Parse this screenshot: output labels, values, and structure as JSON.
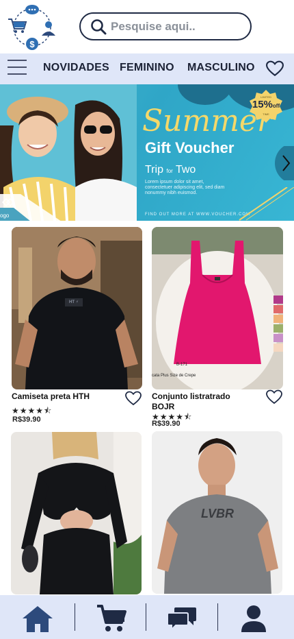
{
  "header": {
    "search_placeholder": "Pesquise aqui.."
  },
  "nav": {
    "items": [
      "NOVIDADES",
      "FEMININO",
      "MASCULINO"
    ]
  },
  "banner": {
    "title": "Summer",
    "subtitle": "Gift Voucher",
    "trip_prefix": "Trip",
    "trip_for": "for",
    "trip_suffix": "Two",
    "body": "Lorem ipsum dolor sit amet, consectetuer adipiscing elit, sed diam nonummy nibh euismod.",
    "find_out": "FIND OUT MORE AT WWW.VOUCHER.COM",
    "badge_percent": "15%",
    "badge_off": "off",
    "badge_top": "LIMITED",
    "badge_bottom": "TIME",
    "logo_text": "ogo"
  },
  "products": [
    {
      "name": "Camiseta preta HTH",
      "rating": 4.5,
      "stars": "★★★★⯪",
      "price": "R$39.90",
      "shirt_print": "HT ⚡"
    },
    {
      "name": "Conjunto listratrado BOJR",
      "rating": 4.5,
      "stars": "★★★★⯪",
      "price": "R$39.90",
      "tag_code": "B-171",
      "tag_text": "cata Plus Size de Crepe"
    },
    {
      "name": "",
      "price": ""
    },
    {
      "name": "",
      "price": "",
      "shirt_print": "LVBR"
    }
  ],
  "colors": {
    "nav_bg": "#dfe6f8",
    "accent": "#2d4a7c",
    "banner": "#2fa6c7"
  },
  "icons": [
    "logo-cart-icon",
    "search-icon",
    "menu-icon",
    "heart-icon",
    "home-icon",
    "cart-icon",
    "chat-icon",
    "user-icon"
  ]
}
